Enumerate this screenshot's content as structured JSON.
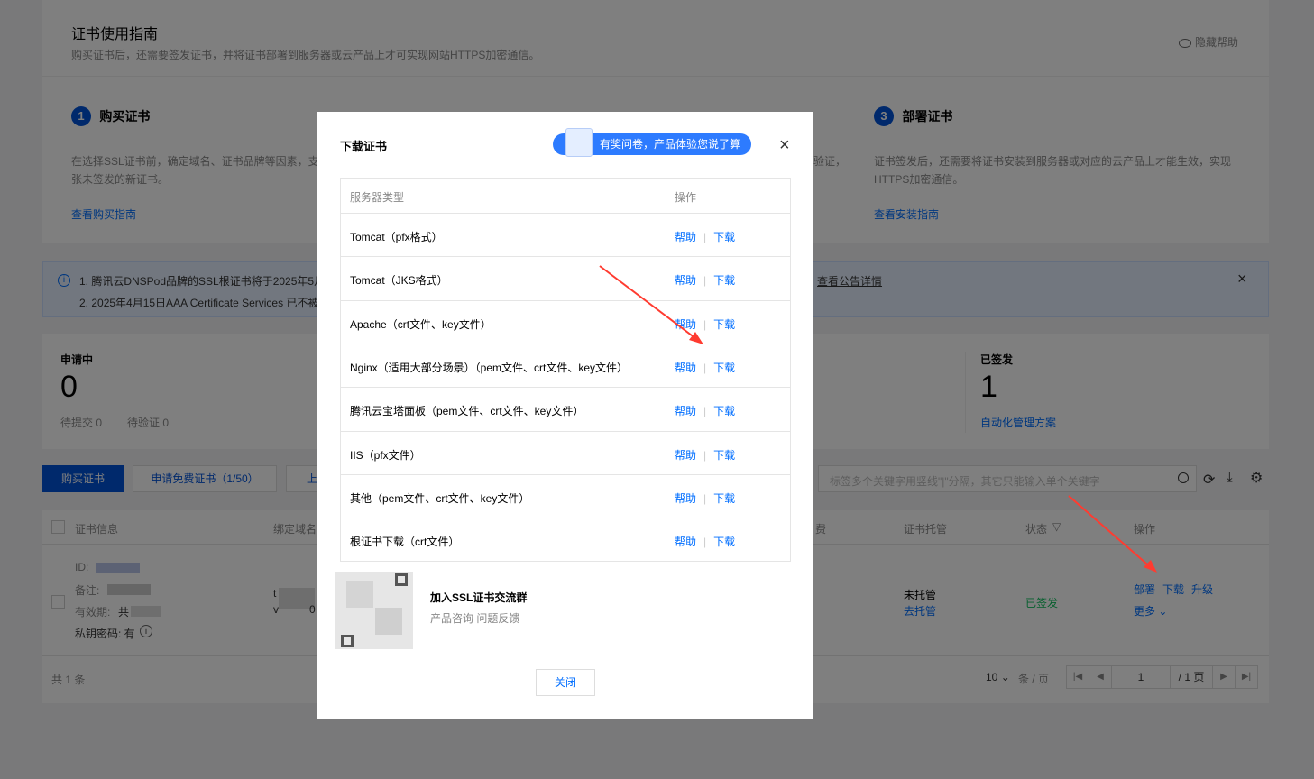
{
  "guide": {
    "title": "证书使用指南",
    "subtitle": "购买证书后，还需要签发证书，并将证书部署到服务器或云产品上才可实现网站HTTPS加密通信。",
    "hide_help": "隐藏帮助",
    "steps": [
      {
        "num": "1",
        "title": "购买证书",
        "desc1": "在选择SSL证书前，确定域名、证书品牌等因素，支",
        "desc2": "张未签发的新证书。",
        "link": "查看购买指南"
      },
      {
        "num": "3",
        "title": "部署证书",
        "desc1": "证书签发后，还需要将证书安装到服务器或对应的云产品上才能生效，实现",
        "desc2": "HTTPS加密通信。",
        "link": "查看安装指南"
      }
    ],
    "step1_tail": "验证，"
  },
  "notice": {
    "line1": "1. 腾讯云DNSPod品牌的SSL根证书将于2025年5月",
    "line2": "2. 2025年4月15日AAA Certificate Services 已不被",
    "link": "查看公告详情"
  },
  "stats": {
    "pending_label": "申请中",
    "pending_value": "0",
    "to_submit": "待提交 0",
    "to_verify": "待验证 0",
    "issued_label": "已签发",
    "issued_value": "1",
    "auto_link": "自动化管理方案"
  },
  "toolbar": {
    "buy": "购买证书",
    "free": "申请免费证书（1/50）",
    "upload_partial": "上",
    "search_placeholder": "标签多个关键字用竖线\"|\"分隔，其它只能输入单个关键字"
  },
  "table": {
    "headers": {
      "info": "证书信息",
      "domain": "绑定域名",
      "fee_partial": "费",
      "hosting": "证书托管",
      "status": "状态",
      "ops": "操作"
    },
    "row": {
      "id_label": "ID:",
      "remark_label": "备注:",
      "expiry_label": "有效期:",
      "expiry_partial": "共",
      "key_label": "私钥密码: 有",
      "domain_partial1": "t",
      "domain_partial2": "v",
      "domain_partial3": "0",
      "hosting": "未托管",
      "hosting_link": "去托管",
      "status": "已签发",
      "ops": [
        "部署",
        "下载",
        "升级"
      ],
      "more": "更多"
    },
    "total": "共 1 条",
    "page_size": "10",
    "per_page": "条 / 页",
    "page": "1",
    "page_total": "/ 1 页"
  },
  "modal": {
    "title": "下载证书",
    "survey": "有奖问卷，产品体验您说了算",
    "col_type": "服务器类型",
    "col_ops": "操作",
    "help": "帮助",
    "download": "下载",
    "rows": [
      "Tomcat（pfx格式）",
      "Tomcat（JKS格式）",
      "Apache（crt文件、key文件）",
      "Nginx（适用大部分场景）（pem文件、crt文件、key文件）",
      "腾讯云宝塔面板（pem文件、crt文件、key文件）",
      "IIS（pfx文件）",
      "其他（pem文件、crt文件、key文件）",
      "根证书下载（crt文件）"
    ],
    "group_title": "加入SSL证书交流群",
    "group_desc": "产品咨询 问题反馈",
    "close": "关闭"
  },
  "colors": {
    "accent": "#006eff",
    "primary_btn": "#0052d9",
    "success": "#0abf5b",
    "arrow": "#ff3b30"
  }
}
